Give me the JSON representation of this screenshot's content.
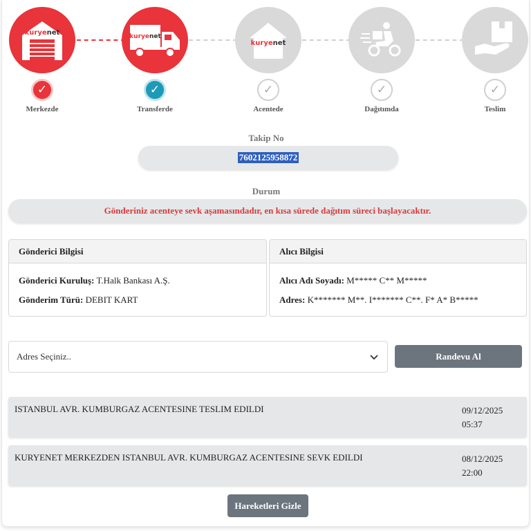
{
  "steps": [
    {
      "label": "Merkezde",
      "state": "done"
    },
    {
      "label": "Transferde",
      "state": "current"
    },
    {
      "label": "Acentede",
      "state": "pending"
    },
    {
      "label": "Dağıtımda",
      "state": "pending"
    },
    {
      "label": "Teslim",
      "state": "pending"
    }
  ],
  "logo": {
    "part1": "kurye",
    "part2": "net"
  },
  "tracking": {
    "title": "Takip No",
    "number": "7602125958872"
  },
  "status": {
    "title": "Durum",
    "message": "Gönderiniz acenteye sevk aşamasındadır, en kısa sürede dağıtım süreci başlayacaktır."
  },
  "sender": {
    "header": "Gönderici Bilgisi",
    "org_label": "Gönderici Kuruluş:",
    "org_value": "T.Halk Bankası A.Ş.",
    "type_label": "Gönderim Türü:",
    "type_value": "DEBIT KART"
  },
  "recipient": {
    "header": "Alıcı Bilgisi",
    "name_label": "Alıcı Adı Soyadı:",
    "name_value": "M***** C** M*****",
    "address_label": "Adres:",
    "address_value": "K******* M**. I******* C**. F* A* B*****"
  },
  "appointment": {
    "select_value": "Adres Seçiniz..",
    "button_label": "Randevu Al"
  },
  "movements": [
    {
      "description": "ISTANBUL AVR. KUMBURGAZ ACENTESINE TESLIM EDILDI",
      "date": "09/12/2025",
      "time": "05:37"
    },
    {
      "description": "KURYENET MERKEZDEN ISTANBUL AVR. KUMBURGAZ ACENTESINE SEVK EDILDI",
      "date": "08/12/2025",
      "time": "22:00"
    }
  ],
  "hide_button_label": "Hareketleri Gizle",
  "colors": {
    "accent": "#e8343a",
    "current": "#1e9ab9",
    "button": "#6c757d"
  }
}
